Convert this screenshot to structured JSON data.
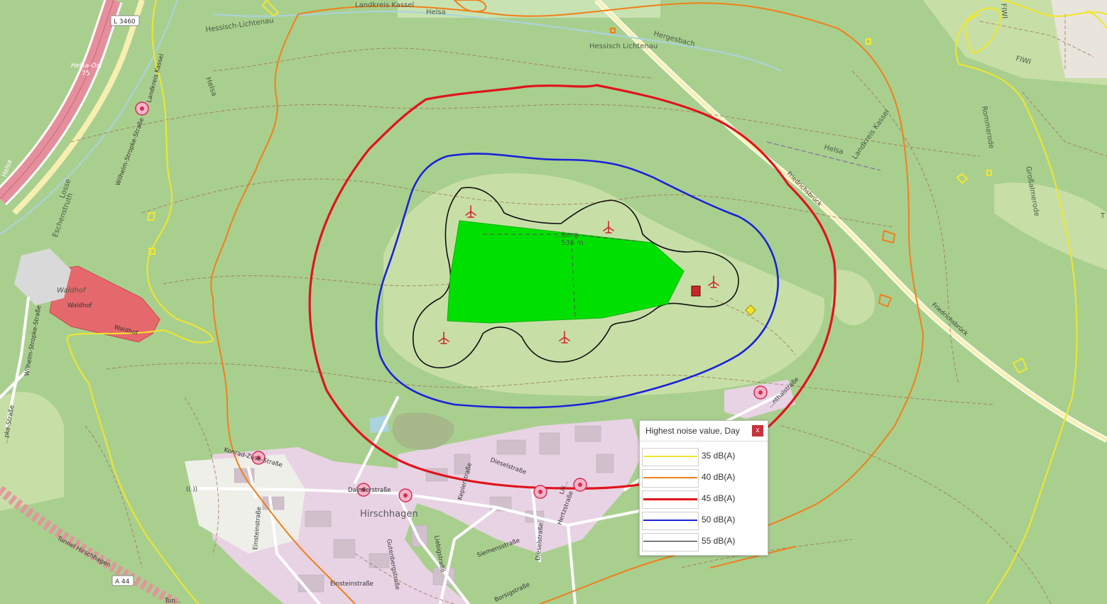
{
  "colors": {
    "forest": "#a9cf8f",
    "meadow": "#cde0ad",
    "park_area": "#00e000",
    "c35": "#f1e62c",
    "c40": "#f07f1a",
    "c45": "#e0141b",
    "c50": "#1a23d8",
    "c55": "#111111",
    "industrial": "#e6cfe2",
    "settlement_red": "#e5696c",
    "motorway": "#e58f9c"
  },
  "map_labels": {
    "landkreis_kassel_top": "Landkreis Kassel",
    "helsa_top": "Helsa",
    "hessisch_lichtenau_top": "Hessisch-Lichtenau",
    "hessisch_lichtenau": "Hessisch Lichtenau",
    "hergesbach": "Hergesbach",
    "helsa_ost": "Helsa-Ost",
    "exit_75": "75",
    "l3460": "L 3460",
    "landkreis_kassel_left": "Landkreis Kassel",
    "helsa_left": "Helsa",
    "losse": "Losse",
    "eschenstruth": "Eschenstruth",
    "helsa_small": "Helsa",
    "wilhelm_stropke_1": "Wilhelm-Stropke-Straße",
    "waldhof_town": "Waldhof",
    "waldhof": "Waldhof",
    "waldhof_small": "Waldhof",
    "wilhelm_stropke_2": "Wilhelm-Stropke-Straße",
    "strasse_left": "...pke-Straße",
    "peak_name": "...berg",
    "peak_elev": "536 m",
    "friedrichsbruck_1": "Friedrichsbrück",
    "friedrichsbruck_2": "Friedrichsbrück",
    "helsa_right": "Helsa",
    "landkreis_kassel_right": "Landkreis Kassel",
    "rommerode": "Rommerode",
    "grossalmerode": "Großalmerode",
    "t_right": "T",
    "fiwi_1": "FIWI",
    "fiwi_2": "FIWI",
    "konrad_zuse": "Konrad-Zuse-Straße",
    "daimlerstrasse": "Daimlerstraße",
    "hirschhagen": "Hirschhagen",
    "einsteinstrasse_1": "Einsteinstraße",
    "kepplerstrasse": "Keplerstraße",
    "dieselstrasse_1": "Dieselstraße",
    "liebigstrasse": "Liebigstraße",
    "siemensstrasse": "Siemensstraße",
    "gutenbergstrasse": "Gutenbergstraße",
    "dieselstrasse_2": "Dieselstraße",
    "hertzstrasse": "Hertzstraße",
    "einsteinstrasse_2": "Einsteinstraße",
    "borsigstrasse": "Borsigstraße",
    "lilien": "Lili...",
    "nthalstrasse": "...nthalstraße",
    "tunnel_hirschhagen": "Tunnel Hirschhagen",
    "a44": "A 44",
    "tun": "Tun..."
  },
  "legend": {
    "title": "Highest noise value, Day",
    "close_label": "x",
    "items": [
      {
        "label": "35 dB(A)",
        "color": "#f1e62c",
        "weight": 2
      },
      {
        "label": "40 dB(A)",
        "color": "#f07f1a",
        "weight": 2
      },
      {
        "label": "45 dB(A)",
        "color": "#e0141b",
        "weight": 3
      },
      {
        "label": "50 dB(A)",
        "color": "#1a23d8",
        "weight": 2.5
      },
      {
        "label": "55 dB(A)",
        "color": "#111111",
        "weight": 1.5
      }
    ]
  }
}
